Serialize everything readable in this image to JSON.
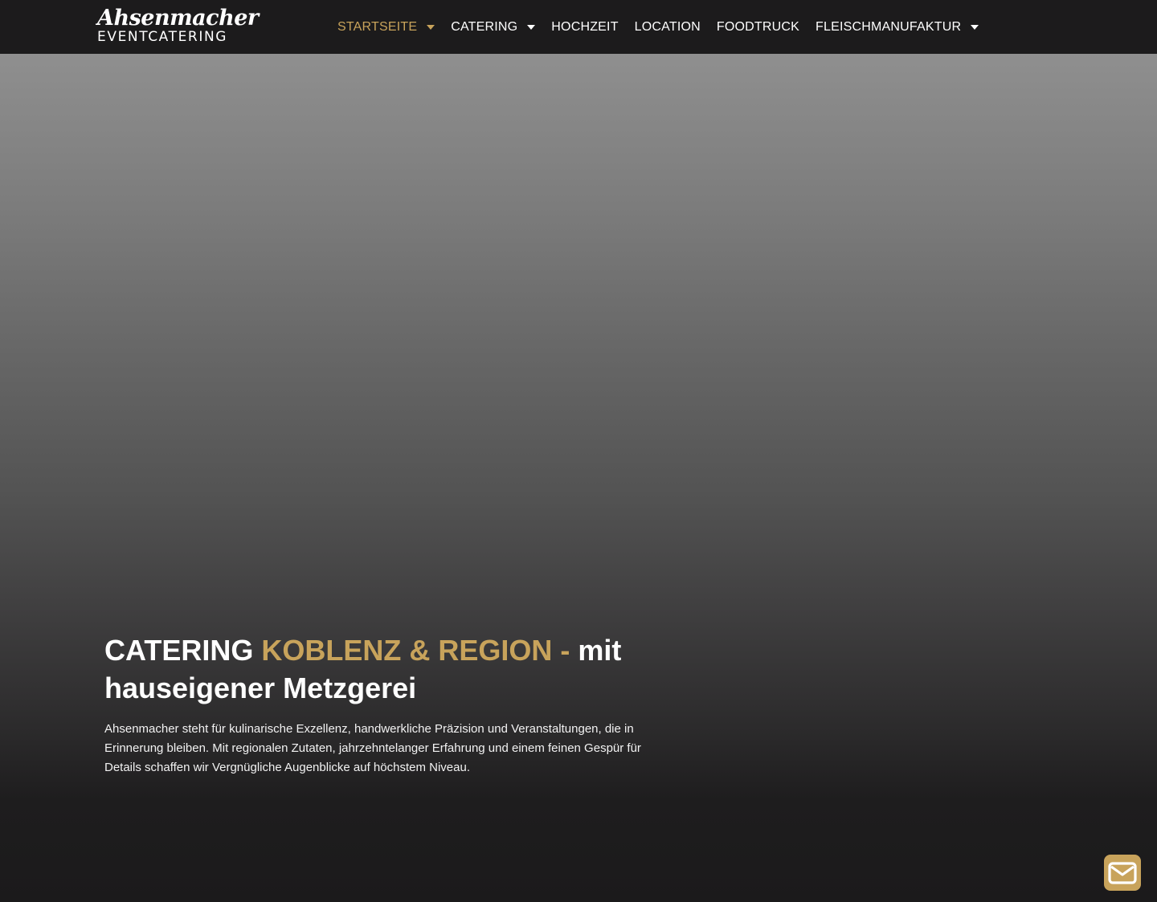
{
  "brand": {
    "script": "Ahsenmacher",
    "subtitle": "EVENTCATERING"
  },
  "nav": {
    "items": [
      {
        "label": "STARTSEITE",
        "active": true,
        "dropdown": true
      },
      {
        "label": "CATERING",
        "active": false,
        "dropdown": true
      },
      {
        "label": "HOCHZEIT",
        "active": false,
        "dropdown": false
      },
      {
        "label": "LOCATION",
        "active": false,
        "dropdown": false
      },
      {
        "label": "FOODTRUCK",
        "active": false,
        "dropdown": false
      },
      {
        "label": "FLEISCHMANUFAKTUR",
        "active": false,
        "dropdown": true
      }
    ]
  },
  "hero": {
    "title_part1": "CATERING ",
    "title_accent": "KOBLENZ & REGION - ",
    "title_part2": "mit hauseigener Metzgerei",
    "text": "Ahsenmacher steht für kulinarische Exzellenz, handwerkliche Präzision und Veranstaltungen, die in Erinnerung bleiben. Mit regionalen Zutaten, jahrzehntelanger Erfahrung und einem feinen Gespür für Details schaffen wir Vergnügliche Augenblicke auf höchstem Niveau."
  },
  "contact_button": {
    "icon": "envelope-icon"
  },
  "colors": {
    "accent": "#c8a35b",
    "header_bg": "#1c1b1c",
    "bottom_bg": "#1b1a1b"
  }
}
